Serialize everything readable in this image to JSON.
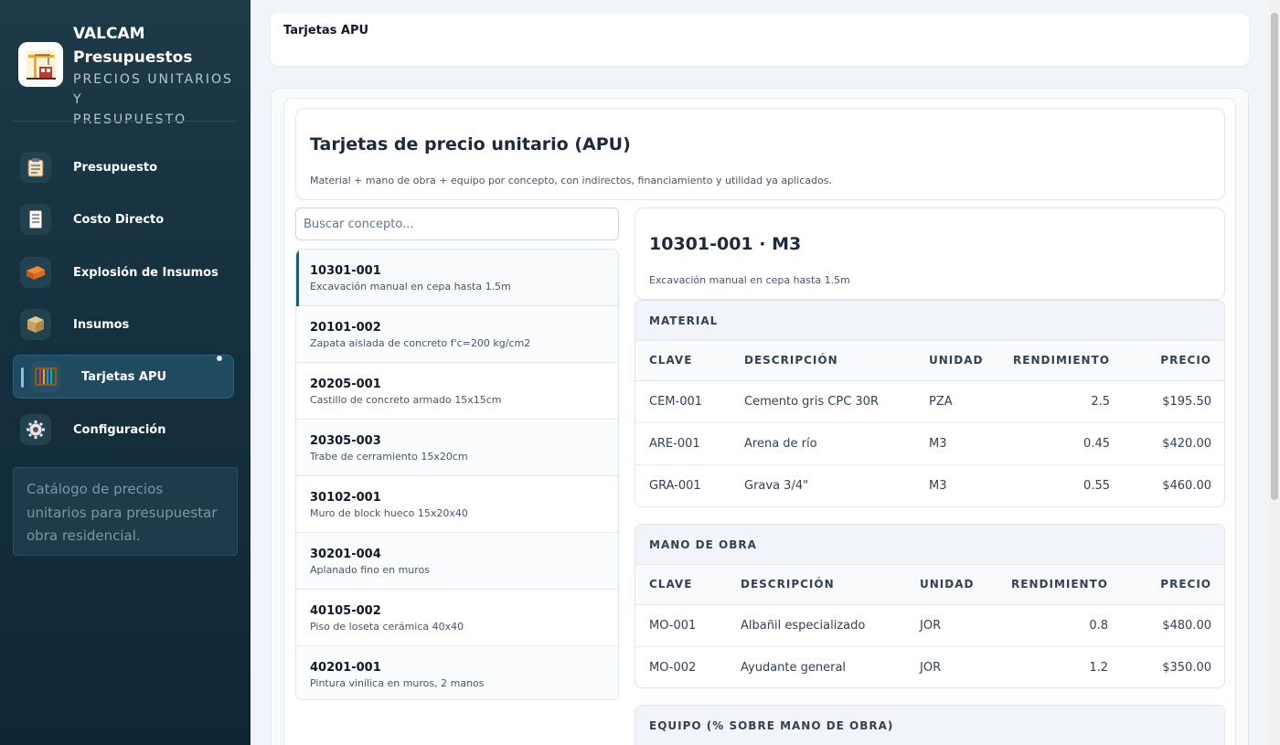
{
  "brand": {
    "title_line1": "VALCAM",
    "title_line2": "Presupuestos",
    "subtitle_line1": "PRECIOS UNITARIOS Y",
    "subtitle_line2": "PRESUPUESTO"
  },
  "sidebar": {
    "items": [
      {
        "label": "Presupuesto",
        "icon": "clipboard-icon"
      },
      {
        "label": "Costo Directo",
        "icon": "document-icon"
      },
      {
        "label": "Explosión de Insumos",
        "icon": "bricks-icon"
      },
      {
        "label": "Insumos",
        "icon": "box-icon"
      },
      {
        "label": "Tarjetas APU",
        "icon": "abacus-icon",
        "active": true
      },
      {
        "label": "Configuración",
        "icon": "gear-icon"
      }
    ],
    "note": "Catálogo de precios unitarios para presupuestar obra residencial."
  },
  "topbar": {
    "title": "Tarjetas APU"
  },
  "header": {
    "title": "Tarjetas de precio unitario (APU)",
    "description": "Material + mano de obra + equipo por concepto, con indirectos, financiamiento y utilidad ya aplicados."
  },
  "search": {
    "placeholder": "Buscar concepto...",
    "value": ""
  },
  "concepts": [
    {
      "code": "10301-001",
      "desc": "Excavación manual en cepa hasta 1.5m"
    },
    {
      "code": "20101-002",
      "desc": "Zapata aislada de concreto f'c=200 kg/cm2"
    },
    {
      "code": "20205-001",
      "desc": "Castillo de concreto armado 15x15cm"
    },
    {
      "code": "20305-003",
      "desc": "Trabe de cerramiento 15x20cm"
    },
    {
      "code": "30102-001",
      "desc": "Muro de block hueco 15x20x40"
    },
    {
      "code": "30201-004",
      "desc": "Aplanado fino en muros"
    },
    {
      "code": "40105-002",
      "desc": "Piso de loseta cerámica 40x40"
    },
    {
      "code": "40201-001",
      "desc": "Pintura vinílica en muros, 2 manos"
    }
  ],
  "detail": {
    "title": "10301-001 · M3",
    "description": "Excavación manual en cepa hasta 1.5m"
  },
  "columns": {
    "clave": "CLAVE",
    "descripcion": "DESCRIPCIÓN",
    "unidad": "UNIDAD",
    "rendimiento": "RENDIMIENTO",
    "precio": "PRECIO"
  },
  "material": {
    "title": "MATERIAL",
    "rows": [
      {
        "clave": "CEM-001",
        "descripcion": "Cemento gris CPC 30R",
        "unidad": "PZA",
        "rendimiento": "2.5",
        "precio": "$195.50"
      },
      {
        "clave": "ARE-001",
        "descripcion": "Arena de río",
        "unidad": "M3",
        "rendimiento": "0.45",
        "precio": "$420.00"
      },
      {
        "clave": "GRA-001",
        "descripcion": "Grava 3/4\"",
        "unidad": "M3",
        "rendimiento": "0.55",
        "precio": "$460.00"
      }
    ]
  },
  "mano_obra": {
    "title": "MANO DE OBRA",
    "rows": [
      {
        "clave": "MO-001",
        "descripcion": "Albañil especializado",
        "unidad": "JOR",
        "rendimiento": "0.8",
        "precio": "$480.00"
      },
      {
        "clave": "MO-002",
        "descripcion": "Ayudante general",
        "unidad": "JOR",
        "rendimiento": "1.2",
        "precio": "$350.00"
      }
    ]
  },
  "equipo": {
    "title": "EQUIPO (% SOBRE MANO DE OBRA)"
  }
}
